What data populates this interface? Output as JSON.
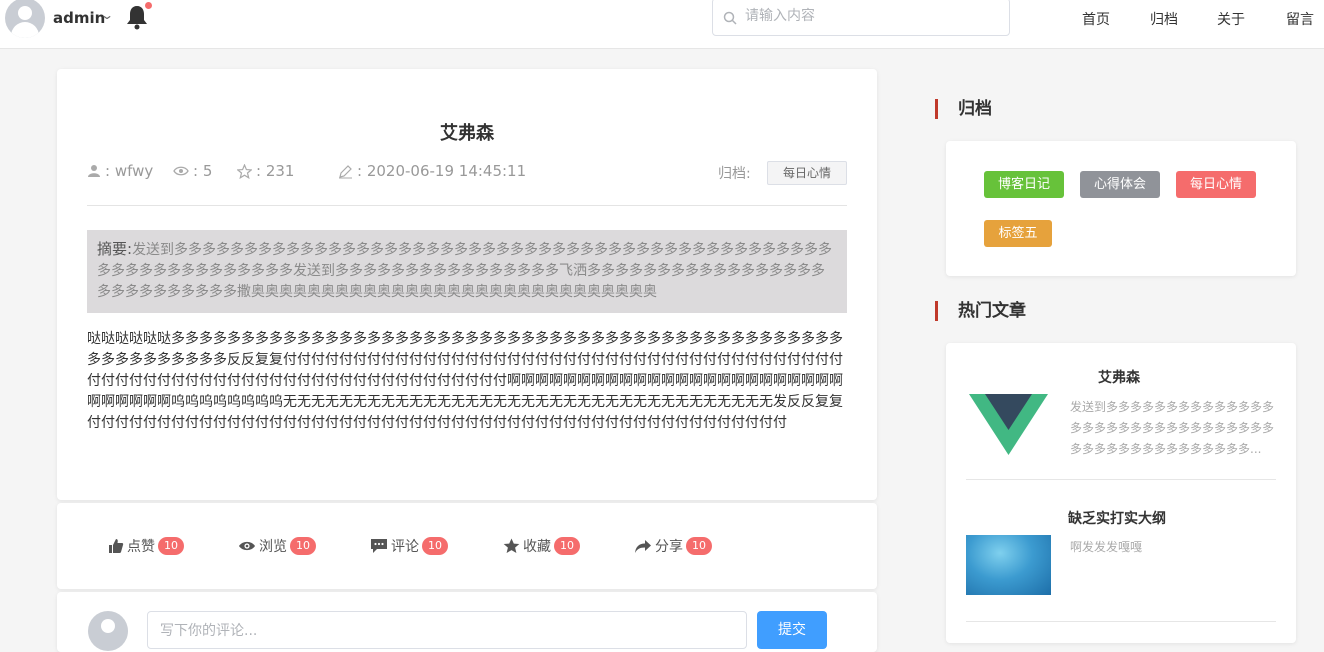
{
  "header": {
    "username": "admin",
    "search_placeholder": "请输入内容",
    "nav": [
      "首页",
      "归档",
      "关于",
      "留言"
    ]
  },
  "article": {
    "title": "艾弗森",
    "author": "wfwy",
    "views": "5",
    "stars": "231",
    "date": "2020-06-19 14:45:11",
    "archive_label": "归档:",
    "archive_tag": "每日心情",
    "summary_label": "摘要:",
    "summary_text": "发送到多多多多多多多多多多多多多多多多多多多多多多多多多多多多多多多多多多多多多多多多多多多多多多多多多多多多多多多多多多多多多发送到多多多多多多多多多多多多多多多多飞洒多多多多多多多多多多多多多多多多多多多多多多多多多多多撒奥奥奥奥奥奥奥奥奥奥奥奥奥奥奥奥奥奥奥奥奥奥奥奥奥奥奥奥奥",
    "content": "哒哒哒哒哒哒多多多多多多多多多多多多多多多多多多多多多多多多多多多多多多多多多多多多多多多多多多多多多多多多多多多多多多多多多多反反复复付付付付付付付付付付付付付付付付付付付付付付付付付付付付付付付付付付付付付付付付付付付付付付付付付付付付付付付付付付付付付付付付付付付付付付啊啊啊啊啊啊啊啊啊啊啊啊啊啊啊啊啊啊啊啊啊啊啊啊啊啊啊啊啊啊呜呜呜呜呜呜呜呜无无无无无无无无无无无无无无无无无无无无无无无无无无无无无无无无无无无发反反复复付付付付付付付付付付付付付付付付付付付付付付付付付付付付付付付付付付付付付付付付付付付付付付付付付付"
  },
  "actions": [
    {
      "label": "点赞",
      "count": "10"
    },
    {
      "label": "浏览",
      "count": "10"
    },
    {
      "label": "评论",
      "count": "10"
    },
    {
      "label": "收藏",
      "count": "10"
    },
    {
      "label": "分享",
      "count": "10"
    }
  ],
  "comment": {
    "placeholder": "写下你的评论...",
    "submit": "提交"
  },
  "sidebar": {
    "archive_title": "归档",
    "tags": [
      {
        "label": "博客日记",
        "color": "#67c23a"
      },
      {
        "label": "心得体会",
        "color": "#909399"
      },
      {
        "label": "每日心情",
        "color": "#f56c6c"
      },
      {
        "label": "标签五",
        "color": "#e6a23c"
      }
    ],
    "hot_title": "热门文章",
    "hot_posts": [
      {
        "title": "艾弗森",
        "desc": "发送到多多多多多多多多多多多多多多多多多多多多多多多多多多多多多多多多多多多多多多多多多多多多多多..."
      },
      {
        "title": "缺乏实打实大纲",
        "desc": "啊发发发嘎嘎"
      }
    ]
  }
}
